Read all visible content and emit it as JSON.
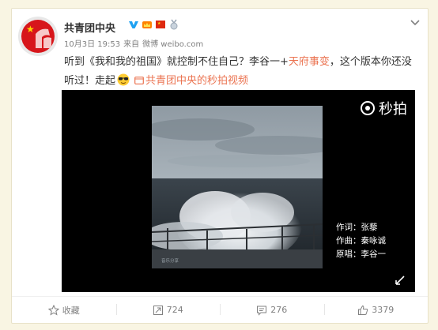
{
  "post": {
    "author": "共青团中央",
    "badges": [
      "verified-icon",
      "member-crown-icon",
      "flag-icon",
      "medal-icon"
    ],
    "date": "10月3日 19:53",
    "via_prefix": "来自",
    "via": "微博 weibo.com",
    "text_a": "听到《我和我的祖国》就控制不住自己？李谷一+",
    "text_link": "天府事变",
    "text_b": "，这个版本你还没听过！走起",
    "emoji": "sunglasses-emoji",
    "source_link": "共青团中央的秒拍视频"
  },
  "video": {
    "watermark": "秒拍",
    "lyricist": "作词：张藜",
    "composer": "作曲：秦咏诚",
    "singer": "原唱：李谷一"
  },
  "actions": {
    "favorite": "收藏",
    "repost": "724",
    "comment": "276",
    "like": "3379"
  },
  "colors": {
    "accent": "#eb7350",
    "verified": "#1da1f2",
    "text": "#333333",
    "muted": "#808080",
    "background": "#f9f5e3"
  }
}
